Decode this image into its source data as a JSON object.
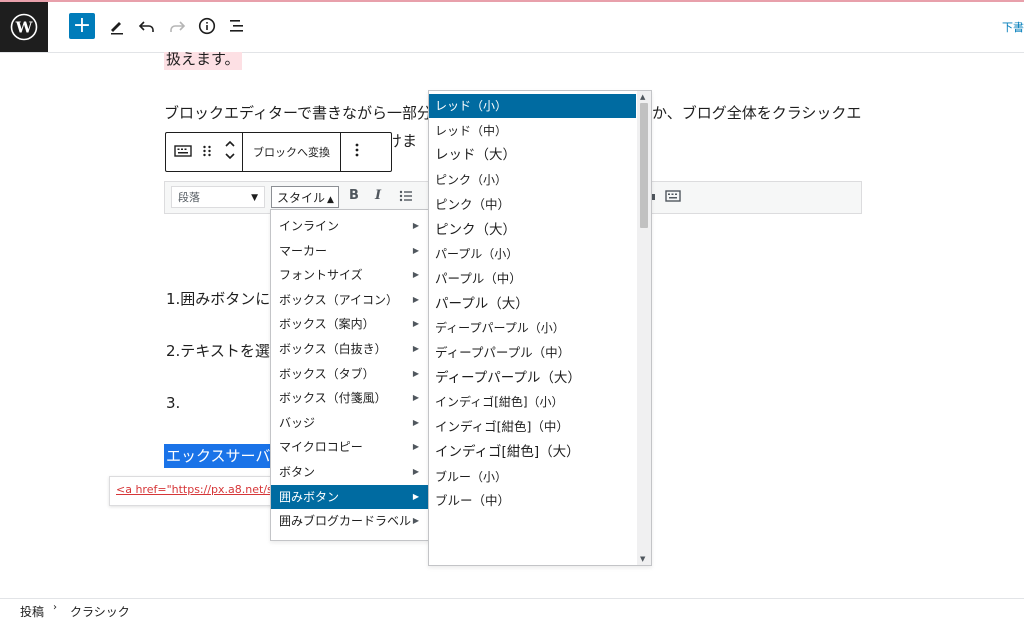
{
  "colors": {
    "accent": "#007cba",
    "menu_active": "#006ba1",
    "selection": "#1a73e8",
    "link": "#d63638",
    "dark": "#1e1e1e"
  },
  "topbar": {
    "logo_icon": "wordpress-logo-icon",
    "add_icon": "plus-icon",
    "tools_icon": "pencil-icon",
    "undo_icon": "undo-icon",
    "redo_icon": "redo-icon",
    "info_icon": "info-icon",
    "outline_icon": "list-view-icon",
    "draft_label": "下書"
  },
  "content": {
    "highlighted_tail": "扱えます。",
    "para1_start": "ブロックエディターで書きながら一部分",
    "para1_end": "か、ブログ全体をクラシックエ",
    "para1_line2": "分けま",
    "block_toolbar": {
      "convert_label": "ブロックへ変換"
    },
    "classic_toolbar": {
      "format_value": "段落",
      "style_label": "スタイル"
    },
    "step1": "1.囲みボタンに",
    "step2": "2.テキストを選",
    "step3": "3.",
    "selected_text": "エックスサーバー",
    "link_text": "<a href=\"https://px.a8.net/svt/ej"
  },
  "style_menu": {
    "items": [
      {
        "label": "インライン"
      },
      {
        "label": "マーカー"
      },
      {
        "label": "フォントサイズ"
      },
      {
        "label": "ボックス（アイコン）"
      },
      {
        "label": "ボックス（案内）"
      },
      {
        "label": "ボックス（白抜き）"
      },
      {
        "label": "ボックス（タブ）"
      },
      {
        "label": "ボックス（付箋風）"
      },
      {
        "label": "バッジ"
      },
      {
        "label": "マイクロコピー"
      },
      {
        "label": "ボタン"
      },
      {
        "label": "囲みボタン"
      },
      {
        "label": "囲みブログカードラベル"
      }
    ]
  },
  "submenu": {
    "items": [
      {
        "label": "レッド（小）"
      },
      {
        "label": "レッド（中）"
      },
      {
        "label": "レッド（大）"
      },
      {
        "label": "ピンク（小）"
      },
      {
        "label": "ピンク（中）"
      },
      {
        "label": "ピンク（大）"
      },
      {
        "label": "パープル（小）"
      },
      {
        "label": "パープル（中）"
      },
      {
        "label": "パープル（大）"
      },
      {
        "label": "ディープパープル（小）"
      },
      {
        "label": "ディープパープル（中）"
      },
      {
        "label": "ディープパープル（大）"
      },
      {
        "label": "インディゴ[紺色]（小）"
      },
      {
        "label": "インディゴ[紺色]（中）"
      },
      {
        "label": "インディゴ[紺色]（大）"
      },
      {
        "label": "ブルー（小）"
      },
      {
        "label": "ブルー（中）"
      }
    ]
  },
  "footer": {
    "crumb1": "投稿",
    "crumb2": "クラシック"
  }
}
